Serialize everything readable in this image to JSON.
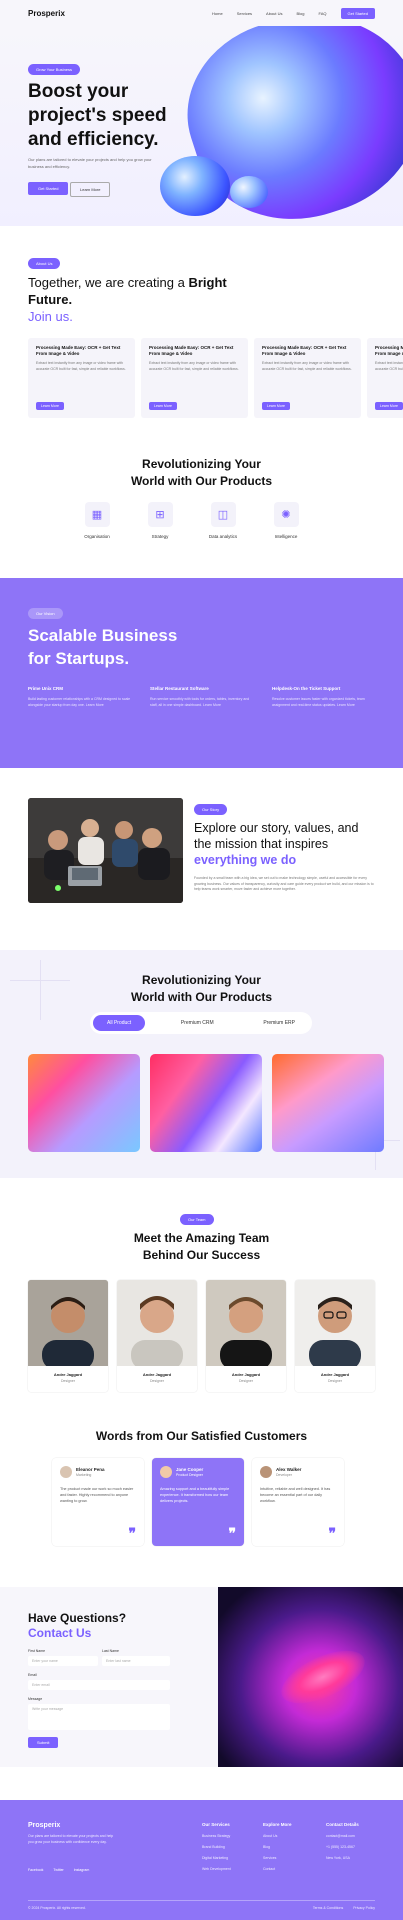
{
  "header": {
    "brand": "Prosperix",
    "nav": [
      "Home",
      "Services",
      "About Us",
      "Blog",
      "FAQ"
    ],
    "cta": "Get Started"
  },
  "hero": {
    "pill": "Grow Your Business",
    "title": "Boost your project's speed and efficiency.",
    "subtitle": "Our plans are tailored to elevate your projects and help you grow your business and efficiency.",
    "primary_button": "Get Started",
    "secondary_button": "Learn More"
  },
  "future": {
    "pill": "About Us",
    "title_plain": "Together, we are creating a ",
    "title_bold": "Bright Future.",
    "title_accent": "Join us.",
    "cards": [
      {
        "title": "Processing Made Easy: OCR + Get Text From Image & Video",
        "desc": "Extract text instantly from any image or video frame with accurate OCR built for fast, simple and reliable workflows.",
        "button": "Learn More"
      },
      {
        "title": "Processing Made Easy: OCR + Get Text From Image & Video",
        "desc": "Extract text instantly from any image or video frame with accurate OCR built for fast, simple and reliable workflows.",
        "button": "Learn More"
      },
      {
        "title": "Processing Made Easy: OCR + Get Text From Image & Video",
        "desc": "Extract text instantly from any image or video frame with accurate OCR built for fast, simple and reliable workflows.",
        "button": "Learn More"
      },
      {
        "title": "Processing Made Easy: OCR + Get Text From Image & Video",
        "desc": "Extract text instantly from any image or video frame with accurate OCR built for fast, simple and reliable workflows.",
        "button": "Learn More"
      }
    ]
  },
  "products1": {
    "title_line1": "Revolutionizing Your",
    "title_line2": "World with Our Products",
    "items": [
      {
        "label": "Organisation",
        "icon": "building-icon"
      },
      {
        "label": "Strategy",
        "icon": "chart-icon"
      },
      {
        "label": "Data analytics",
        "icon": "analytics-icon"
      },
      {
        "label": "Intelligence",
        "icon": "brain-icon"
      }
    ]
  },
  "scalable": {
    "pill": "Our Vision",
    "title_line1": "Scalable Business",
    "title_line2": "for Startups.",
    "columns": [
      {
        "title": "Prime Unix CRM",
        "desc": "Build lasting customer relationships with a CRM designed to scale alongside your startup from day one. Learn More"
      },
      {
        "title": "Stellar Restaurant Software",
        "desc": "Run service smoothly with tools for orders, tables, inventory and staff, all in one simple dashboard. Learn More"
      },
      {
        "title": "Helpdesk-On the Ticket Support",
        "desc": "Resolve customer issues faster with organized tickets, team assignment and real-time status updates. Learn More"
      }
    ]
  },
  "story": {
    "pill": "Our Story",
    "title_line1": "Explore our story, values, and",
    "title_line2": "the mission that inspires",
    "title_accent": "everything we do",
    "body": "Founded by a small team with a big idea, we set out to make technology simple, useful and accessible for every growing business. Our values of transparency, curiosity and care guide every product we build, and our mission is to help teams work smarter, move faster and achieve more together."
  },
  "products2": {
    "title_line1": "Revolutionizing Your",
    "title_line2": "World with Our Products",
    "tabs": [
      "All Product",
      "Premium CRM",
      "Premium ERP"
    ]
  },
  "team": {
    "pill": "Our Team",
    "title_line1": "Meet the Amazing Team",
    "title_line2": "Behind Our Success",
    "members": [
      {
        "name": "Andre Jaggard",
        "role": "Designer"
      },
      {
        "name": "Andre Jaggard",
        "role": "Designer"
      },
      {
        "name": "Andre Jaggard",
        "role": "Designer"
      },
      {
        "name": "Andre Jaggard",
        "role": "Designer"
      }
    ]
  },
  "testimonials": {
    "title": "Words from Our Satisfied Customers",
    "items": [
      {
        "name": "Eleanor Pena",
        "role": "Marketing",
        "quote": "The product made our work so much easier and faster. Highly recommend to anyone wanting to grow."
      },
      {
        "name": "Jane Cooper",
        "role": "Product Designer",
        "quote": "Amazing support and a beautifully simple experience. It transformed how our team delivers projects."
      },
      {
        "name": "Alex Walker",
        "role": "Developer",
        "quote": "Intuitive, reliable and well designed. It has become an essential part of our daily workflow."
      }
    ]
  },
  "contact": {
    "title_line1": "Have Questions?",
    "title_accent": "Contact Us",
    "first_name_label": "First Name",
    "first_name_placeholder": "Enter your name",
    "last_name_label": "Last Name",
    "last_name_placeholder": "Enter last name",
    "email_label": "Email",
    "email_placeholder": "Enter email",
    "message_label": "Message",
    "message_placeholder": "Write your message",
    "send": "Submit"
  },
  "footer": {
    "brand": "Prosperix",
    "desc": "Our plans are tailored to elevate your projects and help you grow your business with confidence every day.",
    "social": [
      "Facebook",
      "Twitter",
      "Instagram"
    ],
    "services": {
      "heading": "Our Services",
      "items": [
        "Business Strategy",
        "Brand Building",
        "Digital Marketing",
        "Web Development"
      ]
    },
    "explore": {
      "heading": "Explore More",
      "items": [
        "About Us",
        "Blog",
        "Services",
        "Contact"
      ]
    },
    "contact": {
      "heading": "Contact Details",
      "items": [
        "contact@mail.com",
        "+1 (555) 123-4567",
        "New York, USA"
      ]
    },
    "copyright": "© 2024 Prosperix. All rights reserved.",
    "legal": [
      "Terms & Conditions",
      "Privacy Policy"
    ]
  }
}
